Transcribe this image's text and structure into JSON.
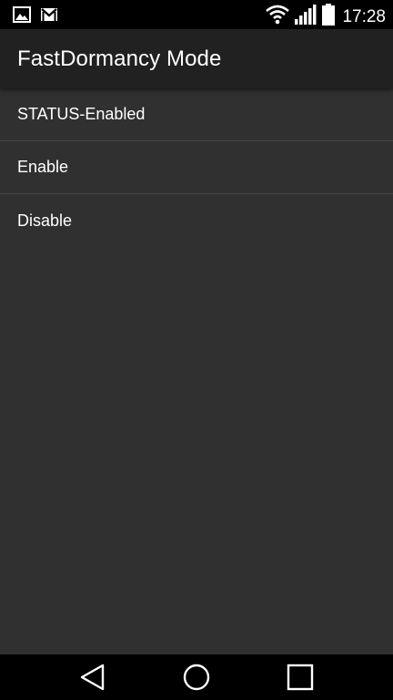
{
  "status_bar": {
    "time": "17:28",
    "left_icons": [
      "image-notification-icon",
      "gmail-notification-icon"
    ],
    "right_icons": [
      "wifi-icon",
      "signal-icon",
      "battery-icon"
    ]
  },
  "app_bar": {
    "title": "FastDormancy Mode"
  },
  "list": {
    "items": [
      {
        "label": "STATUS-Enabled"
      },
      {
        "label": "Enable"
      },
      {
        "label": "Disable"
      }
    ]
  },
  "nav_bar": {
    "buttons": [
      "back-icon",
      "home-icon",
      "recents-icon"
    ]
  },
  "colors": {
    "background": "#303030",
    "app_bar": "#212121",
    "divider": "#464646",
    "text": "#ffffff"
  }
}
